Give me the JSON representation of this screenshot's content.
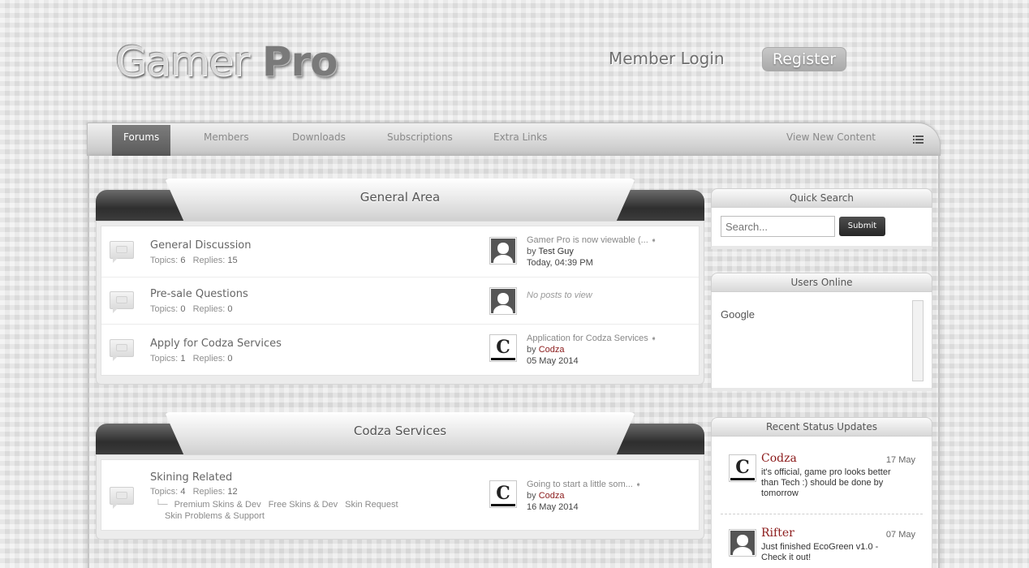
{
  "header": {
    "logo_word1": "Gamer",
    "logo_word2": " Pro",
    "member_login": "Member Login",
    "register": "Register"
  },
  "nav": {
    "items": [
      "Forums",
      "Members",
      "Downloads",
      "Subscriptions",
      "Extra Links"
    ],
    "active": "Forums",
    "view_new_content": "View New Content",
    "menu_icon": "list-icon"
  },
  "categories": [
    {
      "title": "General Area",
      "forums": [
        {
          "name": "General Discussion",
          "topics_label": "Topics:",
          "topics": "6",
          "replies_label": "Replies:",
          "replies": "15",
          "last_post": {
            "title": "Gamer Pro is now viewable (...",
            "by_label": "by",
            "by": "Test Guy",
            "date": "Today, 04:39 PM",
            "avatar": "default-avatar"
          }
        },
        {
          "name": "Pre-sale Questions",
          "topics_label": "Topics:",
          "topics": "0",
          "replies_label": "Replies:",
          "replies": "0",
          "last_post": {
            "empty_text": "No posts to view",
            "avatar": "default-avatar"
          }
        },
        {
          "name": "Apply for Codza Services",
          "topics_label": "Topics:",
          "topics": "1",
          "replies_label": "Replies:",
          "replies": "0",
          "last_post": {
            "title": "Application for Codza Services",
            "by_label": "by",
            "by": "Codza",
            "date": "05 May 2014",
            "avatar": "codza-avatar"
          }
        }
      ]
    },
    {
      "title": "Codza Services",
      "forums": [
        {
          "name": "Skining Related",
          "topics_label": "Topics:",
          "topics": "4",
          "replies_label": "Replies:",
          "replies": "12",
          "subforums": [
            "Premium Skins & Dev",
            "Free Skins & Dev",
            "Skin Request",
            "Skin Problems & Support"
          ],
          "last_post": {
            "title": "Going to start a little som...",
            "by_label": "by",
            "by": "Codza",
            "date": "16 May 2014",
            "avatar": "codza-avatar"
          }
        }
      ]
    }
  ],
  "sidebar": {
    "quick_search": {
      "title": "Quick Search",
      "placeholder": "Search...",
      "submit": "Submit"
    },
    "users_online": {
      "title": "Users Online",
      "users": [
        "Google"
      ]
    },
    "status_updates": {
      "title": "Recent Status Updates",
      "items": [
        {
          "name": "Codza",
          "date": "17 May",
          "text": "it's official, game pro looks better than Tech :) should be done by tomorrow",
          "avatar": "codza-avatar"
        },
        {
          "name": "Rifter",
          "date": "07 May",
          "text": "Just finished EcoGreen v1.0 - Check it out!",
          "avatar": "default-avatar"
        }
      ]
    }
  },
  "colors": {
    "accent_dark": "#2e2e2e",
    "username_red": "#8b1a1a",
    "nav_active": "#6a6a6a"
  }
}
